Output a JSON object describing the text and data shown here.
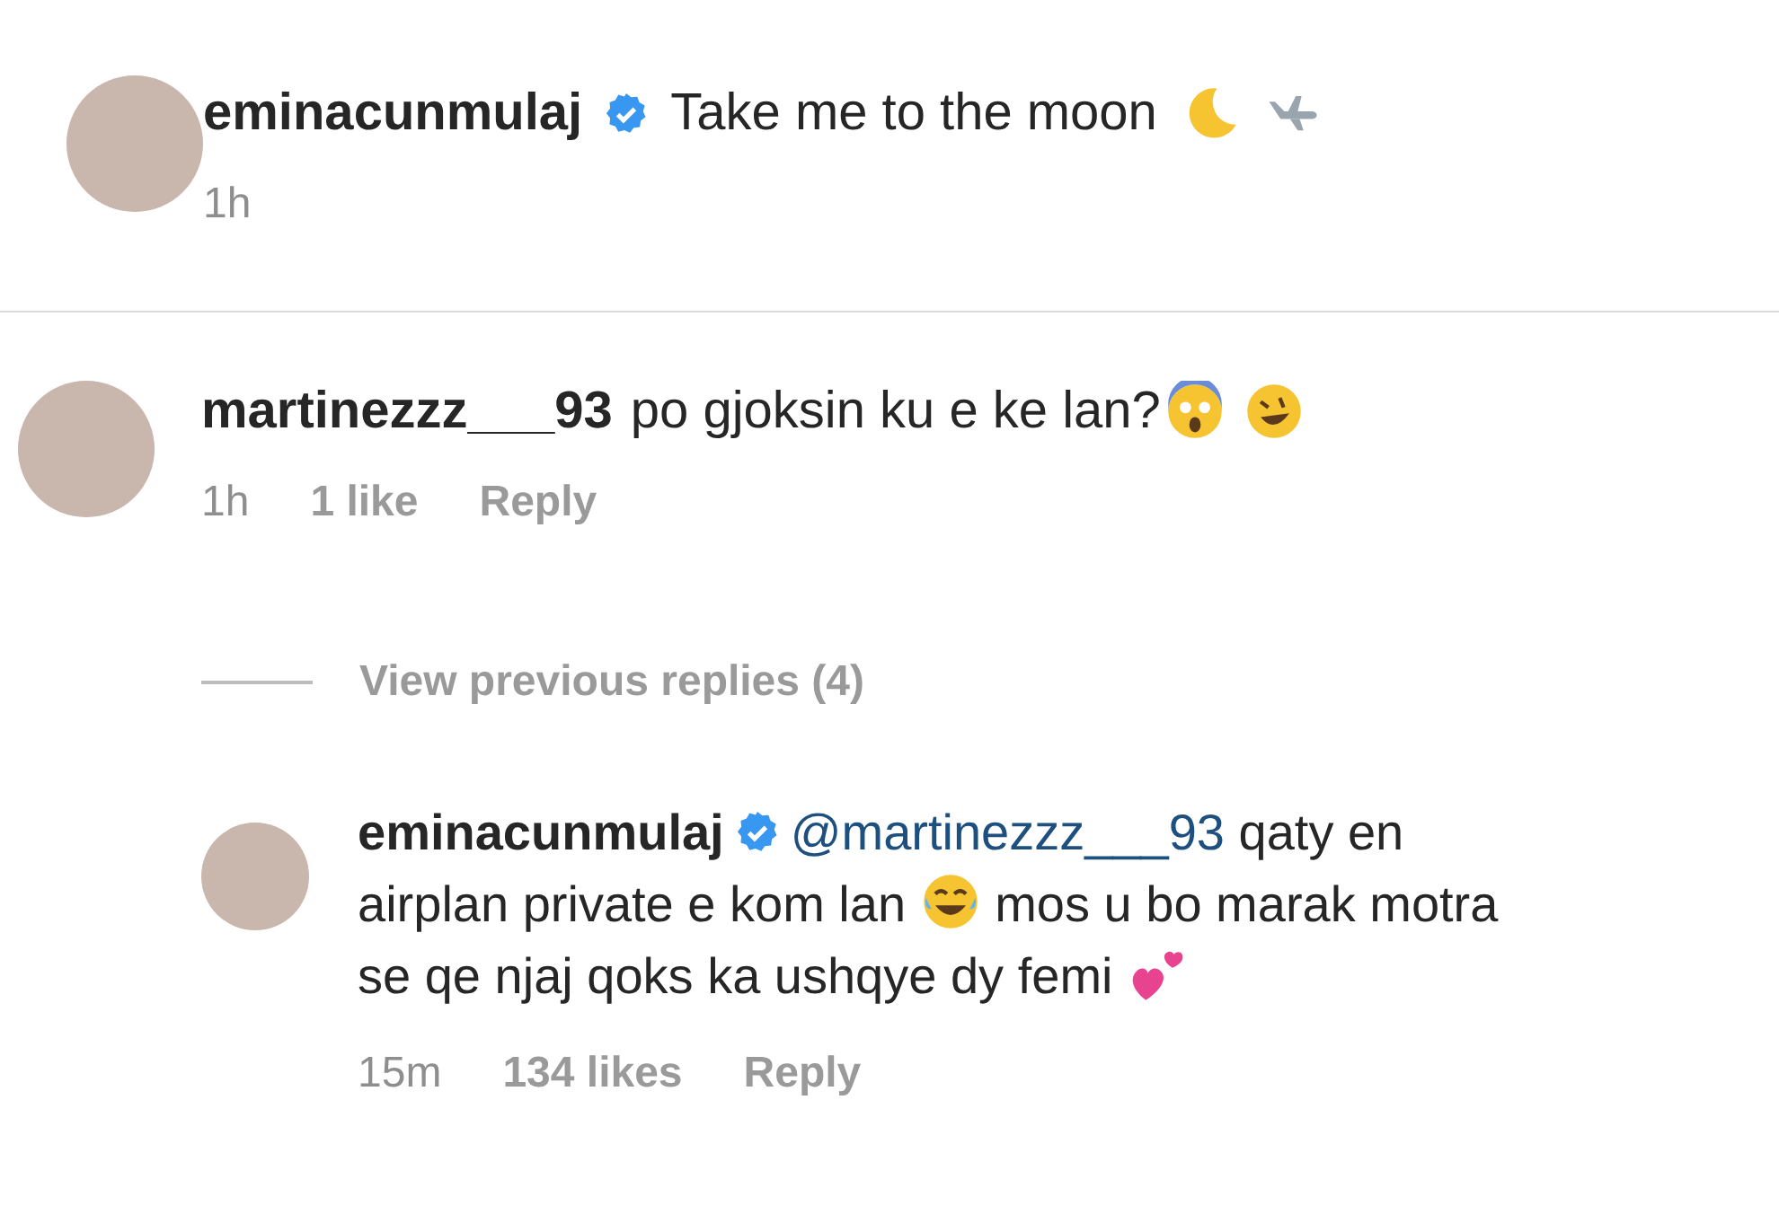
{
  "post": {
    "username": "eminacunmulaj",
    "verified": true,
    "caption": [
      {
        "kind": "text",
        "text": "Take me to the moon"
      },
      {
        "kind": "moon"
      },
      {
        "kind": "airplane"
      }
    ],
    "time": "1h"
  },
  "comment": {
    "username": "martinezzz___93",
    "verified": false,
    "body": [
      {
        "kind": "text",
        "text": "po gjoksin ku e ke lan?"
      },
      {
        "kind": "scream"
      },
      {
        "kind": "rofl"
      }
    ],
    "time": "1h",
    "likes": "1 like",
    "reply": "Reply"
  },
  "view_replies": "View previous replies (4)",
  "reply": {
    "username": "eminacunmulaj",
    "verified": true,
    "body": [
      {
        "kind": "mention",
        "text": "@martinezzz___93"
      },
      {
        "kind": "text",
        "text": "qaty en airplan private e kom lan"
      },
      {
        "kind": "joy"
      },
      {
        "kind": "text",
        "text": "mos u bo marak motra se qe njaj qoks ka ushqye dy femi"
      },
      {
        "kind": "hearts"
      }
    ],
    "time": "15m",
    "likes": "134 likes",
    "reply": "Reply"
  }
}
